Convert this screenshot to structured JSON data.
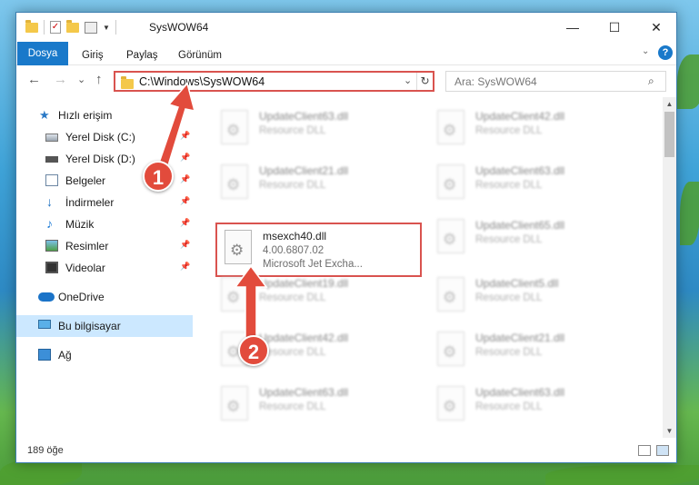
{
  "window": {
    "title": "SysWOW64",
    "minimize_glyph": "—",
    "maximize_glyph": "☐",
    "close_glyph": "✕"
  },
  "ribbon": {
    "tabs": [
      "Dosya",
      "Giriş",
      "Paylaş",
      "Görünüm"
    ],
    "help_glyph": "?"
  },
  "navigation": {
    "back_glyph": "←",
    "forward_glyph": "→",
    "recent_glyph": "⌄",
    "up_glyph": "↑",
    "address": "C:\\Windows\\SysWOW64",
    "search_placeholder": "Ara: SysWOW64"
  },
  "sidebar": {
    "items": [
      {
        "label": "Hızlı erişim",
        "icon": "star-icon"
      },
      {
        "label": "Yerel Disk (C:)",
        "icon": "drive-icon",
        "pinned": true
      },
      {
        "label": "Yerel Disk (D:)",
        "icon": "drive-icon",
        "pinned": true
      },
      {
        "label": "Belgeler",
        "icon": "documents-icon",
        "pinned": true
      },
      {
        "label": "İndirmeler",
        "icon": "download-icon",
        "pinned": true
      },
      {
        "label": "Müzik",
        "icon": "music-icon",
        "pinned": true
      },
      {
        "label": "Resimler",
        "icon": "pictures-icon",
        "pinned": true
      },
      {
        "label": "Videolar",
        "icon": "videos-icon",
        "pinned": true
      },
      {
        "label": "OneDrive",
        "icon": "cloud-icon"
      },
      {
        "label": "Bu bilgisayar",
        "icon": "computer-icon",
        "selected": true
      },
      {
        "label": "Ağ",
        "icon": "network-icon"
      }
    ]
  },
  "files": [
    {
      "name": "UpdateClient63.dll",
      "type": "Resource DLL"
    },
    {
      "name": "UpdateClient42.dll",
      "type": "Resource DLL"
    },
    {
      "name": "UpdateClient21.dll",
      "type": "Resource DLL"
    },
    {
      "name": "UpdateClient63.dll",
      "type": "Resource DLL"
    },
    {
      "name": "msexch40.dll",
      "version": "4.00.6807.02",
      "description": "Microsoft Jet Excha..."
    },
    {
      "name": "UpdateClient65.dll",
      "type": "Resource DLL"
    },
    {
      "name": "UpdateClient19.dll",
      "type": "Resource DLL"
    },
    {
      "name": "UpdateClient5.dll",
      "type": "Resource DLL"
    },
    {
      "name": "UpdateClient42.dll",
      "type": "Resource DLL"
    },
    {
      "name": "UpdateClient21.dll",
      "type": "Resource DLL"
    },
    {
      "name": "UpdateClient63.dll",
      "type": "Resource DLL"
    },
    {
      "name": "UpdateClient63.dll",
      "type": "Resource DLL"
    }
  ],
  "status": {
    "item_count": "189 öğe"
  },
  "callouts": [
    "1",
    "2"
  ],
  "colors": {
    "accent": "#1979ca",
    "highlight": "#d9534f",
    "selected": "#cce8ff"
  }
}
